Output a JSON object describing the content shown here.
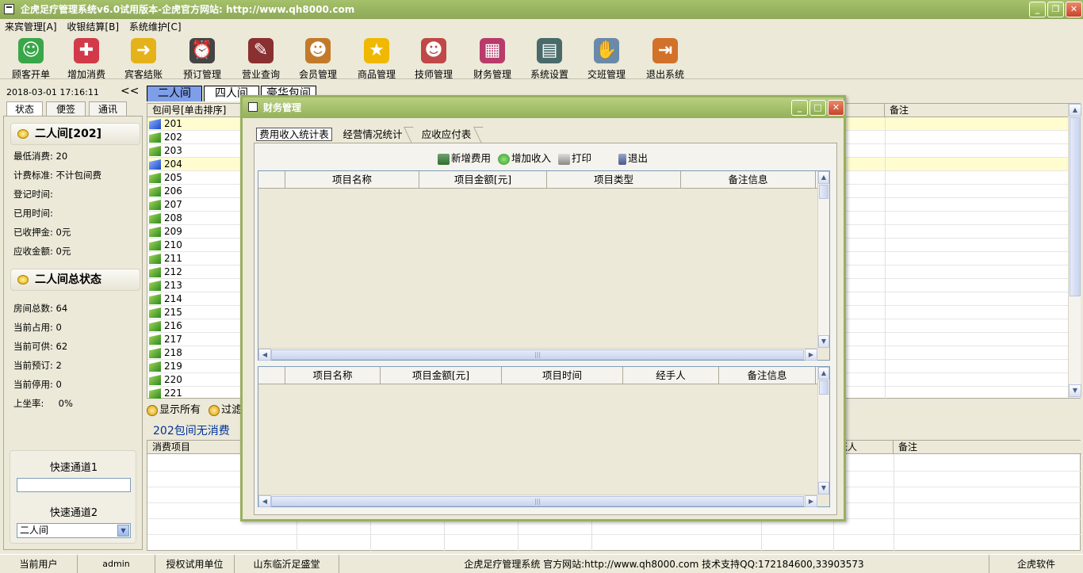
{
  "app": {
    "title": "企虎足疗管理系统v6.0试用版本-企虎官方网站: http://www.qh8000.com"
  },
  "menu": [
    "来宾管理[A]",
    "收银结算[B]",
    "系统维护[C]"
  ],
  "toolbar": [
    {
      "label": "顾客开单",
      "icon": "customer-icon",
      "color": "#3aa64a"
    },
    {
      "label": "增加消费",
      "icon": "add-heart-icon",
      "color": "#d23a4a"
    },
    {
      "label": "宾客结账",
      "icon": "arrow-checkout-icon",
      "color": "#e6b21a"
    },
    {
      "label": "预订管理",
      "icon": "alarm-clock-icon",
      "color": "#444444"
    },
    {
      "label": "营业查询",
      "icon": "business-query-icon",
      "color": "#8a3030"
    },
    {
      "label": "会员管理",
      "icon": "members-icon",
      "color": "#c27a2a"
    },
    {
      "label": "商品管理",
      "icon": "star-icon",
      "color": "#f0b800"
    },
    {
      "label": "技师管理",
      "icon": "technicians-icon",
      "color": "#c04848"
    },
    {
      "label": "财务管理",
      "icon": "finance-icon",
      "color": "#b83b6a"
    },
    {
      "label": "系统设置",
      "icon": "settings-icon",
      "color": "#4a6a6a"
    },
    {
      "label": "交班管理",
      "icon": "handshake-icon",
      "color": "#6a8aa8"
    },
    {
      "label": "退出系统",
      "icon": "exit-icon",
      "color": "#d2712a"
    }
  ],
  "left": {
    "datetime": "2018-03-01 17:16:11",
    "collapse": "<<",
    "tabs": [
      "状态",
      "便签",
      "通讯"
    ],
    "room_header": "二人间[202]",
    "room_stats": [
      "最低消费: 20",
      "计费标准: 不计包间费",
      "登记时间:",
      "已用时间:",
      "已收押金: 0元",
      "应收金额: 0元"
    ],
    "summary_header": "二人间总状态",
    "summary_stats": [
      "房间总数: 64",
      "当前占用: 0",
      "当前可供: 62",
      "当前预订: 2",
      "当前停用: 0",
      "上坐率:     0%"
    ],
    "quick1": "快速通道1",
    "quick2": "快速通道2",
    "quick2_value": "二人间"
  },
  "room_tabs": [
    "二人间",
    "四人间",
    "豪华包间"
  ],
  "grid": {
    "headers": [
      "包间号[单击排序]",
      "备注"
    ],
    "rows": [
      {
        "num": "201",
        "status": "reserved"
      },
      {
        "num": "202",
        "status": "free"
      },
      {
        "num": "203",
        "status": "free"
      },
      {
        "num": "204",
        "status": "reserved"
      },
      {
        "num": "205",
        "status": "free"
      },
      {
        "num": "206",
        "status": "free"
      },
      {
        "num": "207",
        "status": "free"
      },
      {
        "num": "208",
        "status": "free"
      },
      {
        "num": "209",
        "status": "free"
      },
      {
        "num": "210",
        "status": "free"
      },
      {
        "num": "211",
        "status": "free"
      },
      {
        "num": "212",
        "status": "free"
      },
      {
        "num": "213",
        "status": "free"
      },
      {
        "num": "214",
        "status": "free"
      },
      {
        "num": "215",
        "status": "free"
      },
      {
        "num": "216",
        "status": "free"
      },
      {
        "num": "217",
        "status": "free"
      },
      {
        "num": "218",
        "status": "free"
      },
      {
        "num": "219",
        "status": "free"
      },
      {
        "num": "220",
        "status": "free"
      },
      {
        "num": "221",
        "status": "free"
      }
    ]
  },
  "filter": {
    "show_all": "显示所有",
    "filter": "过滤"
  },
  "no_consumption": "202包间无消费",
  "grid2": {
    "headers": [
      "消费项目",
      "账人",
      "备注"
    ]
  },
  "status": {
    "user_label": "当前用户",
    "user": "admin",
    "license_label": "授权试用单位",
    "unit": "山东临沂足盛堂",
    "info": "企虎足疗管理系统 官方网站:http://www.qh8000.com 技术支持QQ:172184600,33903573",
    "vendor": "企虎软件"
  },
  "dialog": {
    "title": "财务管理",
    "tabs": [
      "费用收入统计表",
      "经营情况统计",
      "应收应付表"
    ],
    "buttons": [
      "新增费用",
      "增加收入",
      "打印",
      "退出"
    ],
    "table1_headers": [
      "项目名称",
      "项目金额[元]",
      "项目类型",
      "备注信息"
    ],
    "table2_headers": [
      "项目名称",
      "项目金额[元]",
      "项目时间",
      "经手人",
      "备注信息"
    ]
  }
}
